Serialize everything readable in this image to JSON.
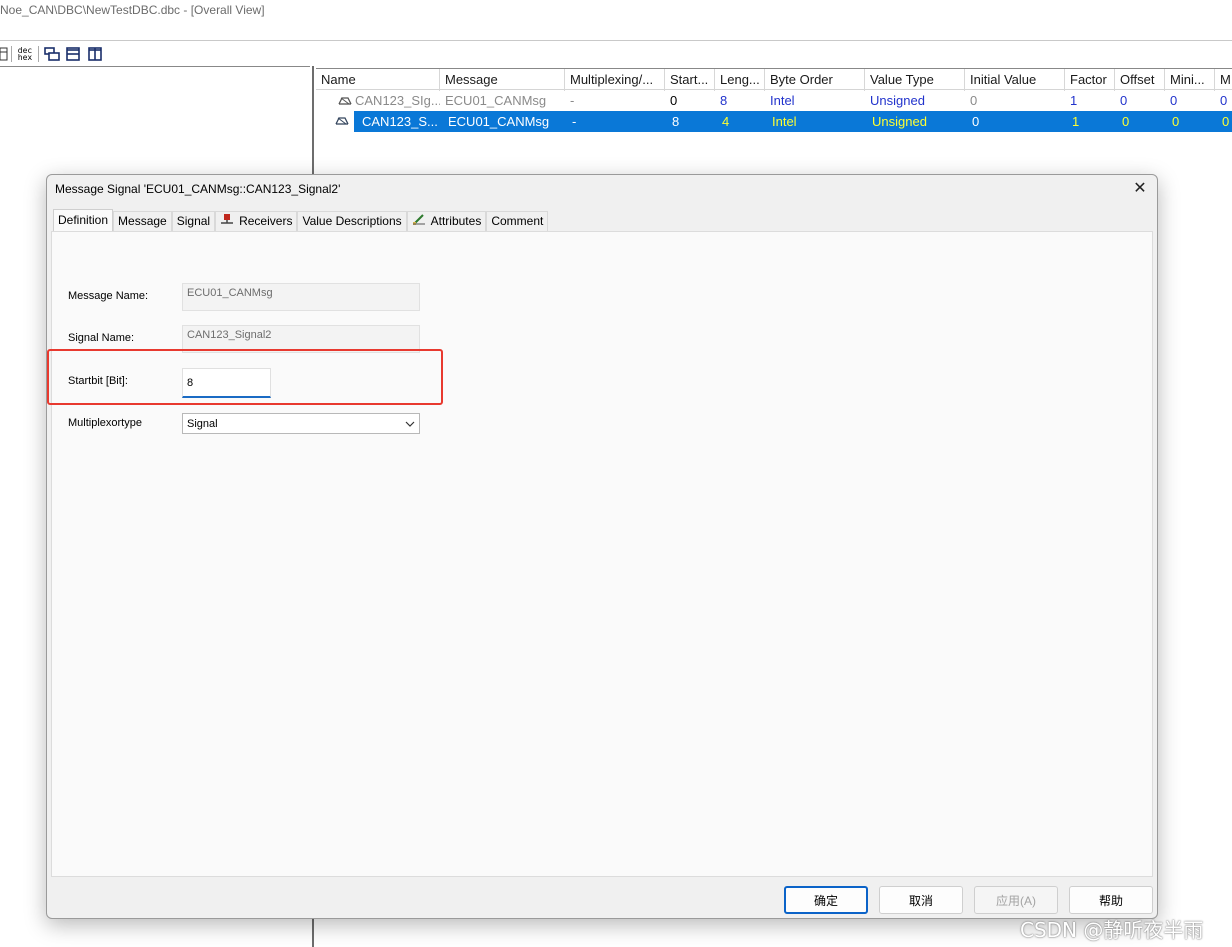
{
  "window": {
    "title": "Noe_CAN\\DBC\\NewTestDBC.dbc - [Overall View]"
  },
  "toolbar": {
    "dec_hex_top": "dec",
    "dec_hex_bottom": "hex"
  },
  "grid": {
    "columns": [
      "Name",
      "Message",
      "Multiplexing/...",
      "Start...",
      "Leng...",
      "Byte Order",
      "Value Type",
      "Initial Value",
      "Factor",
      "Offset",
      "Mini...",
      "M"
    ],
    "rows": [
      {
        "name": "CAN123_SIg...",
        "message": "ECU01_CANMsg",
        "multiplexing": "-",
        "start": "0",
        "length": "8",
        "byte_order": "Intel",
        "value_type": "Unsigned",
        "initial": "0",
        "factor": "1",
        "offset": "0",
        "min": "0",
        "max": "0"
      },
      {
        "name": "CAN123_S...",
        "message": "ECU01_CANMsg",
        "multiplexing": "-",
        "start": "8",
        "length": "4",
        "byte_order": "Intel",
        "value_type": "Unsigned",
        "initial": "0",
        "factor": "1",
        "offset": "0",
        "min": "0",
        "max": "0"
      }
    ]
  },
  "dialog": {
    "title": "Message Signal 'ECU01_CANMsg::CAN123_Signal2'",
    "close": "✕",
    "tabs": [
      "Definition",
      "Message",
      "Signal",
      "Receivers",
      "Value Descriptions",
      "Attributes",
      "Comment"
    ],
    "fields": {
      "message_name_label": "Message Name:",
      "message_name_value": "ECU01_CANMsg",
      "signal_name_label": "Signal Name:",
      "signal_name_value": "CAN123_Signal2",
      "startbit_label": "Startbit [Bit]:",
      "startbit_value": "8",
      "multiplexortype_label": "Multiplexortype",
      "multiplexortype_value": "Signal"
    },
    "buttons": {
      "ok": "确定",
      "cancel": "取消",
      "apply": "应用(A)",
      "help": "帮助"
    }
  },
  "watermark": "CSDN @静听夜半雨",
  "colors": {
    "selection": "#0a78d7",
    "highlight": "#e8392f",
    "value_blue": "#2233cc",
    "selected_yellow": "#ffff33"
  }
}
